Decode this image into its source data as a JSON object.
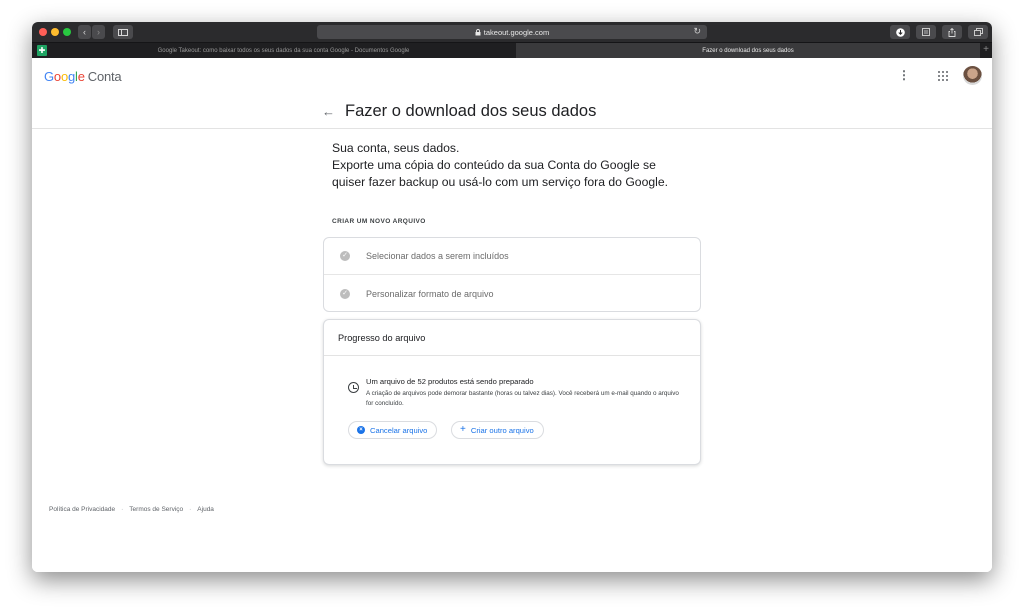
{
  "browser": {
    "url": "takeout.google.com",
    "tabs": [
      {
        "label": "Google Takeout: como baixar todos os seus dados da sua conta Google - Documentos Google",
        "active": false
      },
      {
        "label": "Fazer o download dos seus dados",
        "active": true
      }
    ],
    "new_tab": "+"
  },
  "header": {
    "logo": {
      "letters": [
        {
          "char": "G",
          "color": "#4285f4"
        },
        {
          "char": "o",
          "color": "#ea4335"
        },
        {
          "char": "o",
          "color": "#fbbc05"
        },
        {
          "char": "g",
          "color": "#4285f4"
        },
        {
          "char": "l",
          "color": "#34a853"
        },
        {
          "char": "e",
          "color": "#ea4335"
        }
      ],
      "suffix": "Conta"
    },
    "menu_icon": "more-vert-icon",
    "apps_icon": "apps-grid-icon"
  },
  "title": {
    "back_arrow": "←",
    "text": "Fazer o download dos seus dados"
  },
  "intro": {
    "line1": "Sua conta, seus dados.",
    "line2": "Exporte uma cópia do conteúdo da sua Conta do Google se",
    "line3": "quiser fazer backup ou usá-lo com um serviço fora do Google."
  },
  "section_label": "CRIAR UM NOVO ARQUIVO",
  "steps": [
    {
      "label": "Selecionar dados a serem incluídos",
      "done": true
    },
    {
      "label": "Personalizar formato de arquivo",
      "done": true
    }
  ],
  "progress": {
    "title": "Progresso do arquivo",
    "status": "Um arquivo de 52 produtos está sendo preparado",
    "detail": "A criação de arquivos pode demorar bastante (horas ou talvez dias). Você receberá um e-mail quando o arquivo for concluído.",
    "cancel_label": "Cancelar arquivo",
    "create_label": "Criar outro arquivo"
  },
  "footer": {
    "privacy": "Política de Privacidade",
    "terms": "Termos de Serviço",
    "help": "Ajuda",
    "separator": "·"
  },
  "colors": {
    "accent": "#1a73e8",
    "toolbar": "#2b2b2d",
    "check": "#bdbdbd"
  }
}
